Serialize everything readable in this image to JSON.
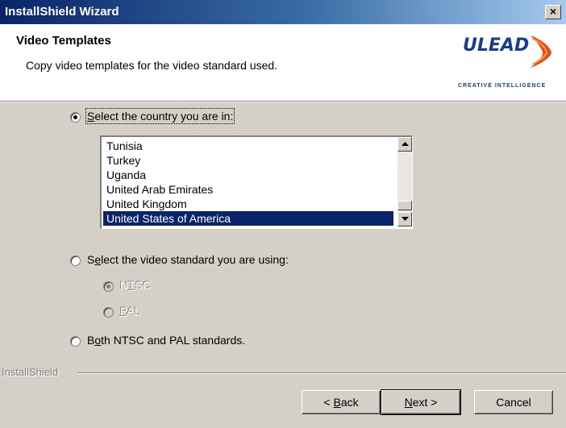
{
  "window": {
    "title": "InstallShield Wizard",
    "close_label": "×"
  },
  "header": {
    "title": "Video Templates",
    "subtitle": "Copy video templates for the video standard used.",
    "logo_text": "ULEAD",
    "logo_tagline": "CREATIVE INTELLIGENCE",
    "brand_color": "#1b3c8c",
    "accent_color": "#e8491d"
  },
  "options": {
    "country": {
      "label_prefix": "",
      "mnemonic": "S",
      "label_rest": "elect the country you are in:",
      "checked": true
    },
    "standard": {
      "label_prefix": "",
      "mnemonic": "e",
      "label_rest_before": "S",
      "label_rest": "lect the video standard you are using:",
      "checked": false
    },
    "ntsc": {
      "mnemonic": "T",
      "before": "N",
      "after": "SC",
      "checked": true,
      "disabled": true
    },
    "pal": {
      "mnemonic": "P",
      "after": "AL",
      "checked": false,
      "disabled": true
    },
    "both": {
      "before": "B",
      "mnemonic": "o",
      "after": "th NTSC and PAL standards.",
      "checked": false
    }
  },
  "country_list": {
    "items": [
      "Tunisia",
      "Turkey",
      "Uganda",
      "United Arab Emirates",
      "United Kingdom",
      "United States of America"
    ],
    "selected": "United States of America",
    "scroll_up_icon": "arrow-up-icon",
    "scroll_down_icon": "arrow-down-icon"
  },
  "footer": {
    "brand": "InstallShield",
    "back_before": "< ",
    "back_mnemonic": "B",
    "back_after": "ack",
    "next_mnemonic": "N",
    "next_after": "ext >",
    "cancel_label": "Cancel"
  }
}
